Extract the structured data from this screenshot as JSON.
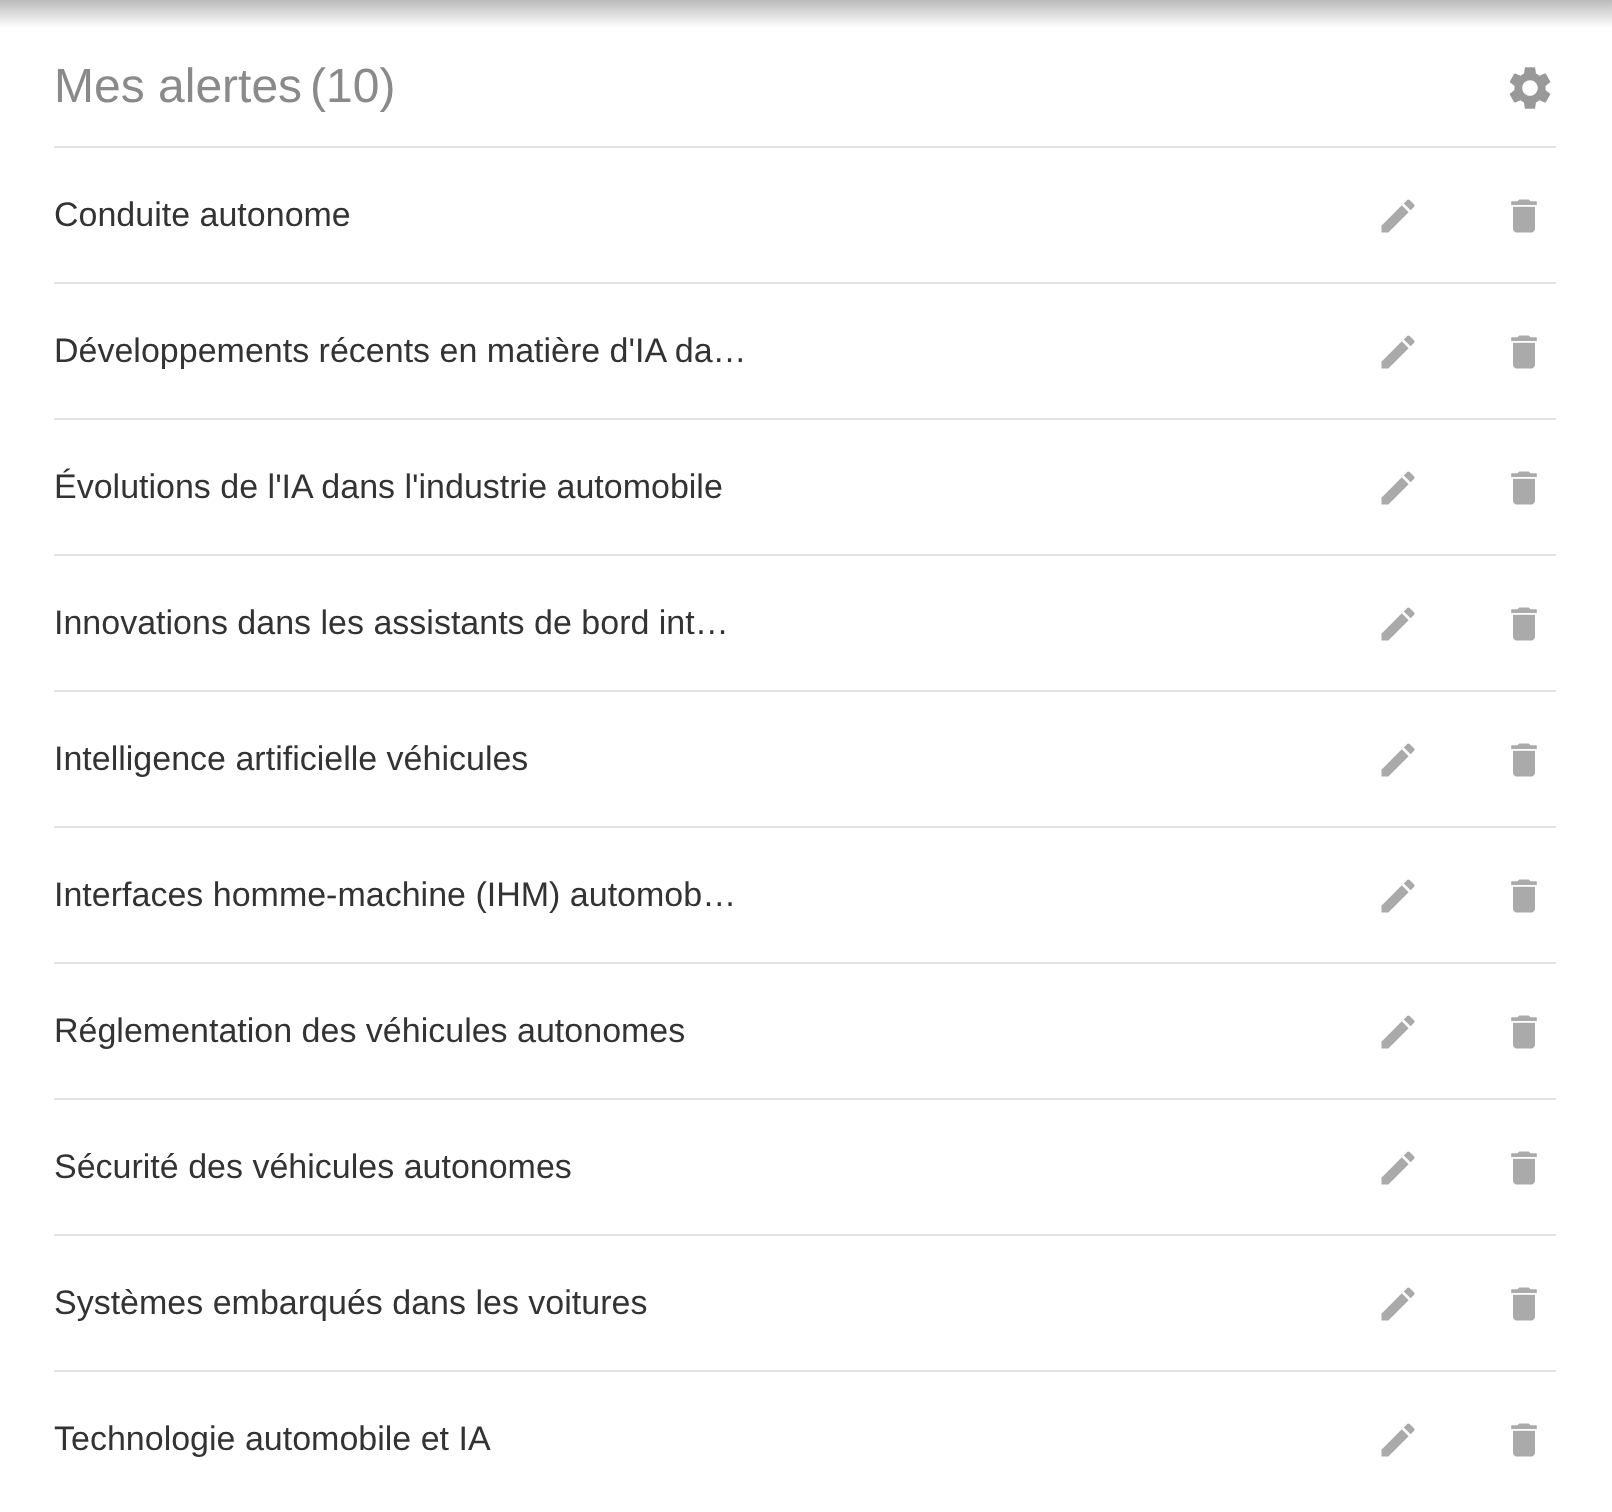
{
  "title": "Mes alertes",
  "count": "(10)",
  "alerts": [
    {
      "name": "Conduite autonome"
    },
    {
      "name": "Développements récents en matière d'IA da…"
    },
    {
      "name": "Évolutions de l'IA dans l'industrie automobile"
    },
    {
      "name": "Innovations dans les assistants de bord int…"
    },
    {
      "name": "Intelligence artificielle véhicules"
    },
    {
      "name": "Interfaces homme-machine (IHM) automob…"
    },
    {
      "name": "Réglementation des véhicules autonomes"
    },
    {
      "name": "Sécurité des véhicules autonomes"
    },
    {
      "name": "Systèmes embarqués dans les voitures"
    },
    {
      "name": "Technologie automobile et IA"
    }
  ]
}
